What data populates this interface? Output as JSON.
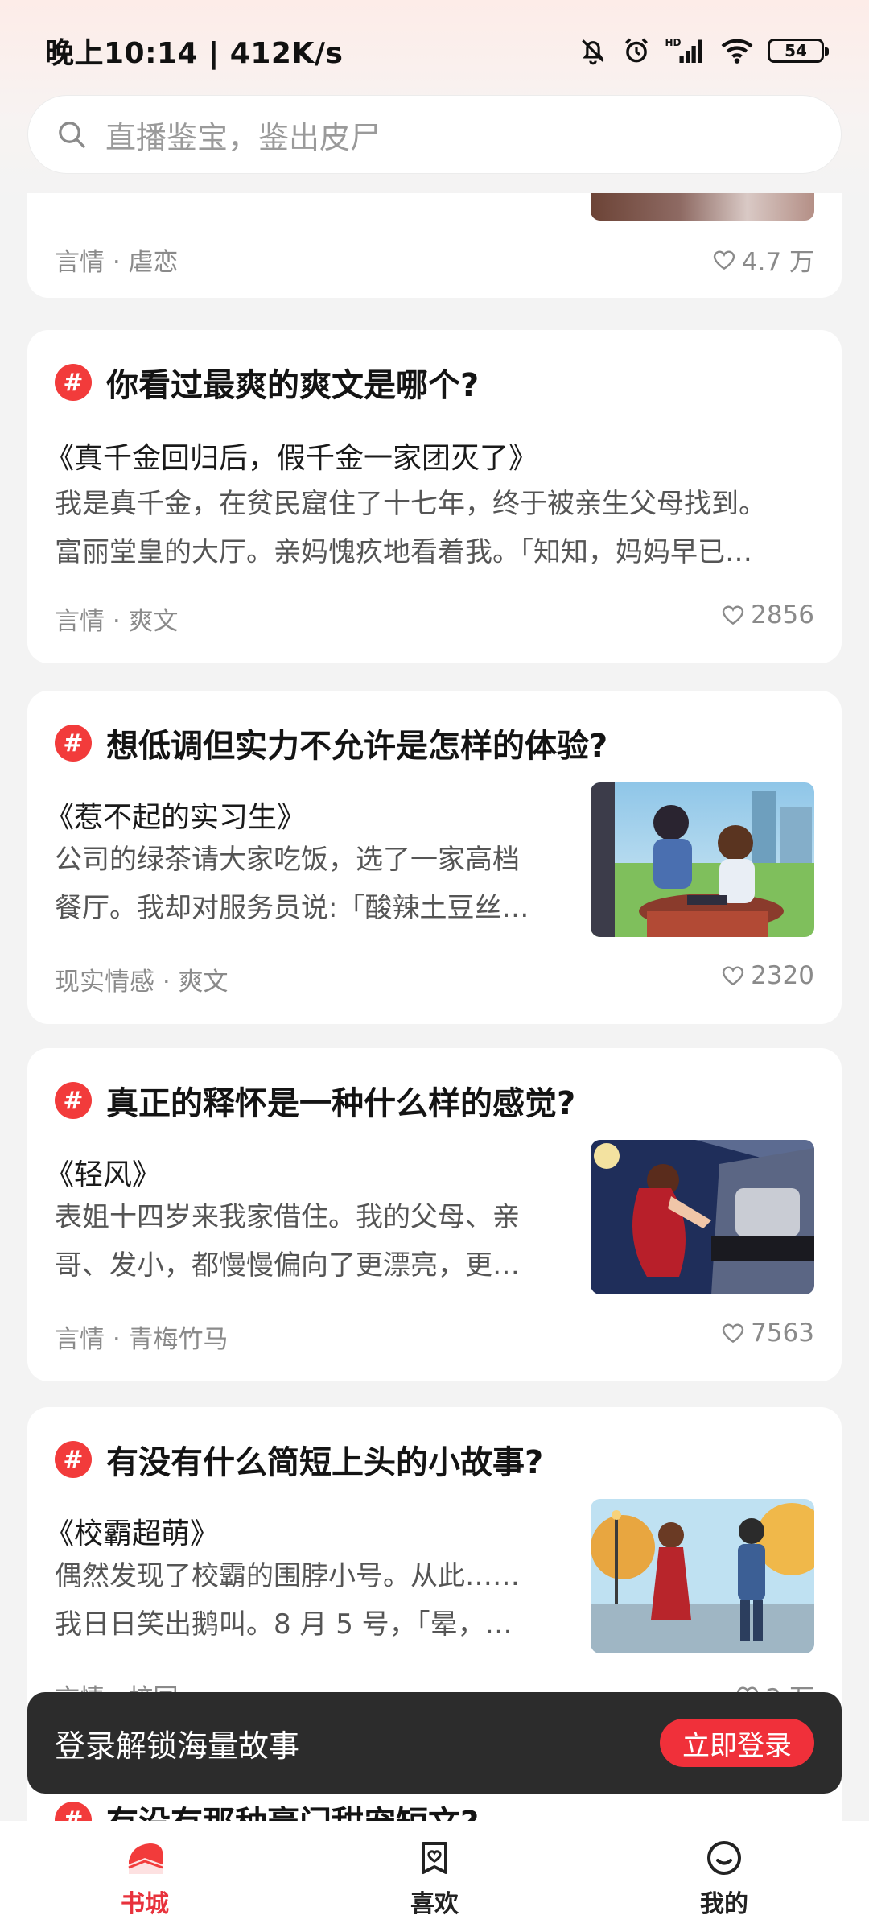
{
  "status_bar": {
    "time": "晚上10:14 | 412K/s",
    "battery": "54"
  },
  "search": {
    "placeholder": "直播鉴宝，鉴出皮尸"
  },
  "top_card": {
    "tags": "言情 · 虐恋",
    "likes": "4.7 万"
  },
  "cards": [
    {
      "question": "你看过最爽的爽文是哪个?",
      "book": "《真千金回归后，假千金一家团灭了》",
      "excerpt": [
        "我是真千金，在贫民窟住了十七年，终于被亲生父母找到。",
        "富丽堂皇的大厅。亲妈愧疚地看着我。「知知，妈妈早已…"
      ],
      "tags": "言情 · 爽文",
      "likes": "2856",
      "has_image": false
    },
    {
      "question": "想低调但实力不允许是怎样的体验?",
      "book": "《惹不起的实习生》",
      "excerpt": [
        "公司的绿茶请大家吃饭，选了一家高档",
        "餐厅。我却对服务员说:「酸辣土豆丝…"
      ],
      "tags": "现实情感 · 爽文",
      "likes": "2320",
      "has_image": true
    },
    {
      "question": "真正的释怀是一种什么样的感觉?",
      "book": "《轻风》",
      "excerpt": [
        "表姐十四岁来我家借住。我的父母、亲",
        "哥、发小，都慢慢偏向了更漂亮，更…"
      ],
      "tags": "言情 · 青梅竹马",
      "likes": "7563",
      "has_image": true
    },
    {
      "question": "有没有什么简短上头的小故事?",
      "book": "《校霸超萌》",
      "excerpt": [
        "偶然发现了校霸的围脖小号。从此……",
        "我日日笑出鹅叫。8 月 5 号，「晕，…"
      ],
      "tags": "言情 · 校园",
      "likes": "2 万",
      "has_image": true
    },
    {
      "question": "有没有那种豪门甜宠短文?"
    }
  ],
  "login_banner": {
    "text": "登录解锁海量故事",
    "button": "立即登录"
  },
  "bottom_nav": [
    {
      "label": "书城",
      "icon": "bookstore-icon",
      "active": true
    },
    {
      "label": "喜欢",
      "icon": "favorites-icon",
      "active": false
    },
    {
      "label": "我的",
      "icon": "profile-icon",
      "active": false
    }
  ],
  "colors": {
    "accent": "#f23b3b",
    "nav_active": "#e8323c",
    "banner_bg": "#2c2c2c"
  }
}
